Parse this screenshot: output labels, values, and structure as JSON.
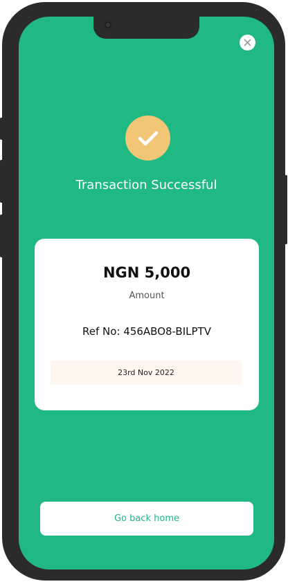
{
  "screen": {
    "status_title": "Transaction Successful",
    "close_icon": "close-icon",
    "success_icon": "checkmark-icon"
  },
  "receipt": {
    "amount": "NGN 5,000",
    "amount_label": "Amount",
    "reference": "Ref No: 456ABO8-BILPTV",
    "date": "23rd Nov 2022"
  },
  "actions": {
    "home_button_label": "Go back home"
  },
  "colors": {
    "background": "#20b883",
    "badge": "#f1c677",
    "date_bar": "#fff7ee",
    "device_frame": "#2b2b2b"
  }
}
